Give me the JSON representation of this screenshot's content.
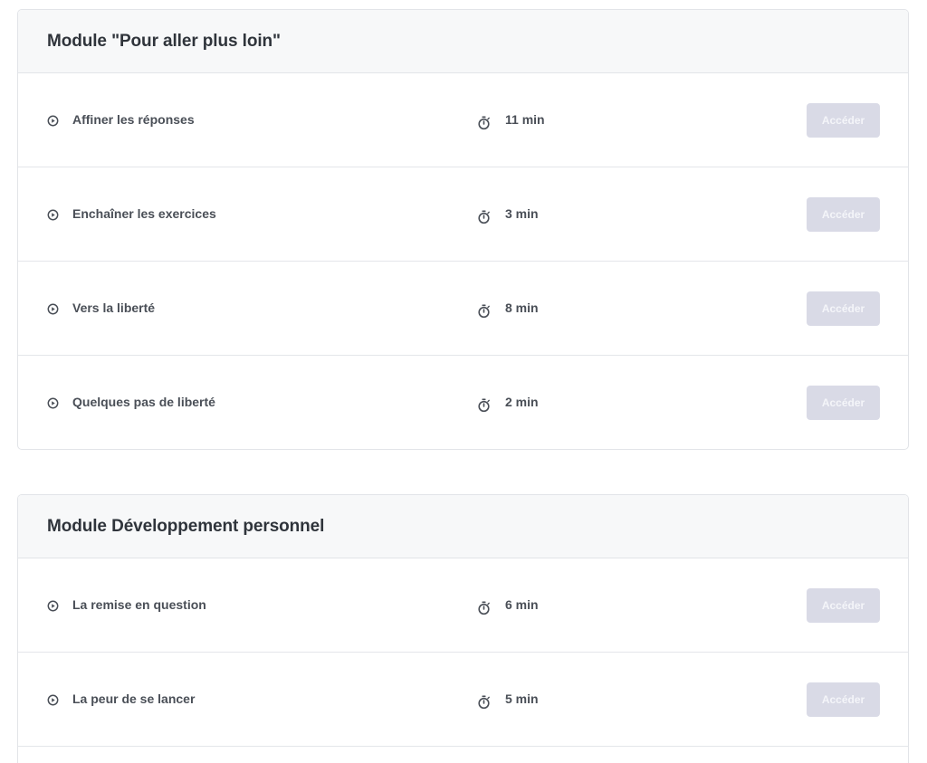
{
  "modules": [
    {
      "title": "Module \"Pour aller plus loin\"",
      "lessons": [
        {
          "title": "Affiner les réponses",
          "duration": "11 min",
          "button": "Accéder"
        },
        {
          "title": "Enchaîner les exercices",
          "duration": "3 min",
          "button": "Accéder"
        },
        {
          "title": "Vers la liberté",
          "duration": "8 min",
          "button": "Accéder"
        },
        {
          "title": "Quelques pas de liberté",
          "duration": "2 min",
          "button": "Accéder"
        }
      ]
    },
    {
      "title": "Module Développement personnel",
      "lessons": [
        {
          "title": "La remise en question",
          "duration": "6 min",
          "button": "Accéder"
        },
        {
          "title": "La peur de se lancer",
          "duration": "5 min",
          "button": "Accéder"
        }
      ]
    }
  ],
  "icons": {
    "play": "play-circle-icon",
    "timer": "stopwatch-icon"
  },
  "colors": {
    "button_bg": "#d9dae6",
    "header_bg": "#f7f8f9",
    "text": "#4a4f57"
  }
}
